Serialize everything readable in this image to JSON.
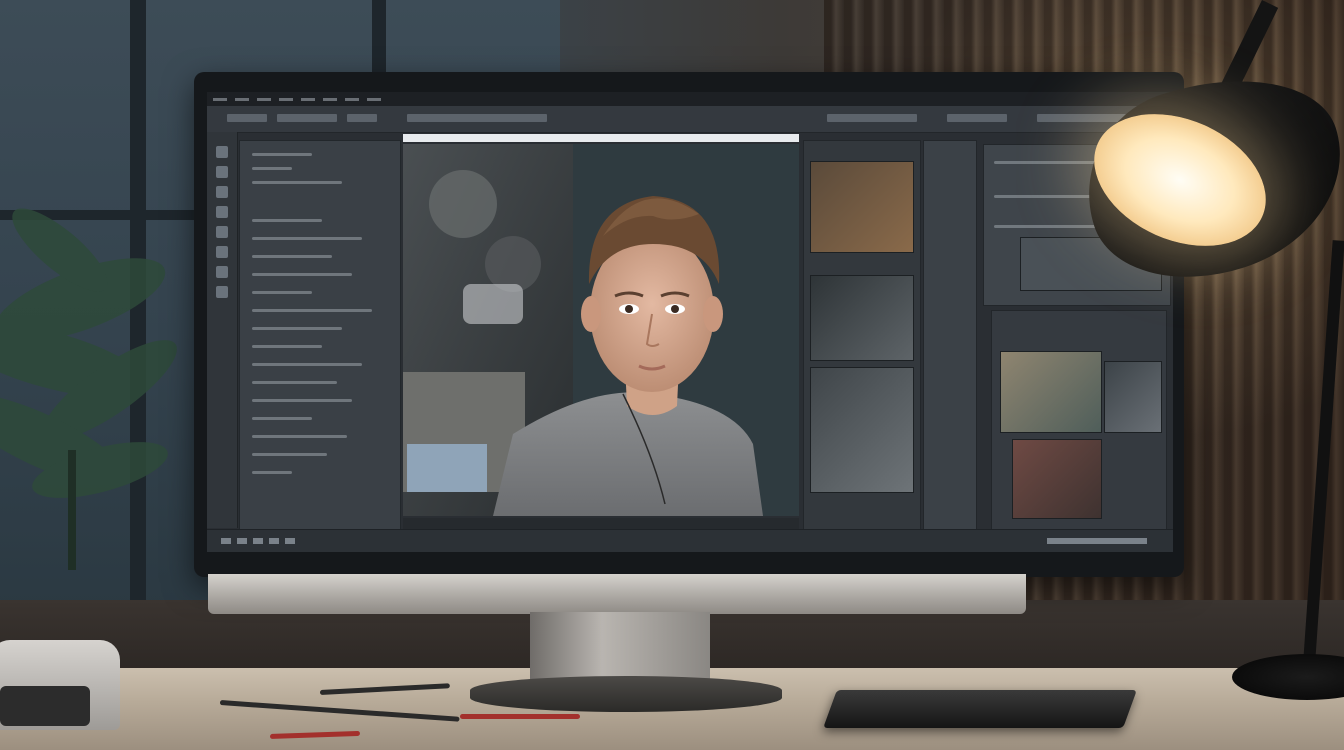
{
  "scene": {
    "type": "photo-editor-monitor-on-desk",
    "colors": {
      "screen_ui": "#2a2e33",
      "panel": "#3a4046",
      "lamp_glow": "#ffe9bd",
      "desk": "#cbbfae"
    }
  },
  "editor": {
    "canvas_status_text": "",
    "icons": [
      "menu-icon",
      "tool-icon",
      "layer-thumbnail-icon"
    ]
  }
}
